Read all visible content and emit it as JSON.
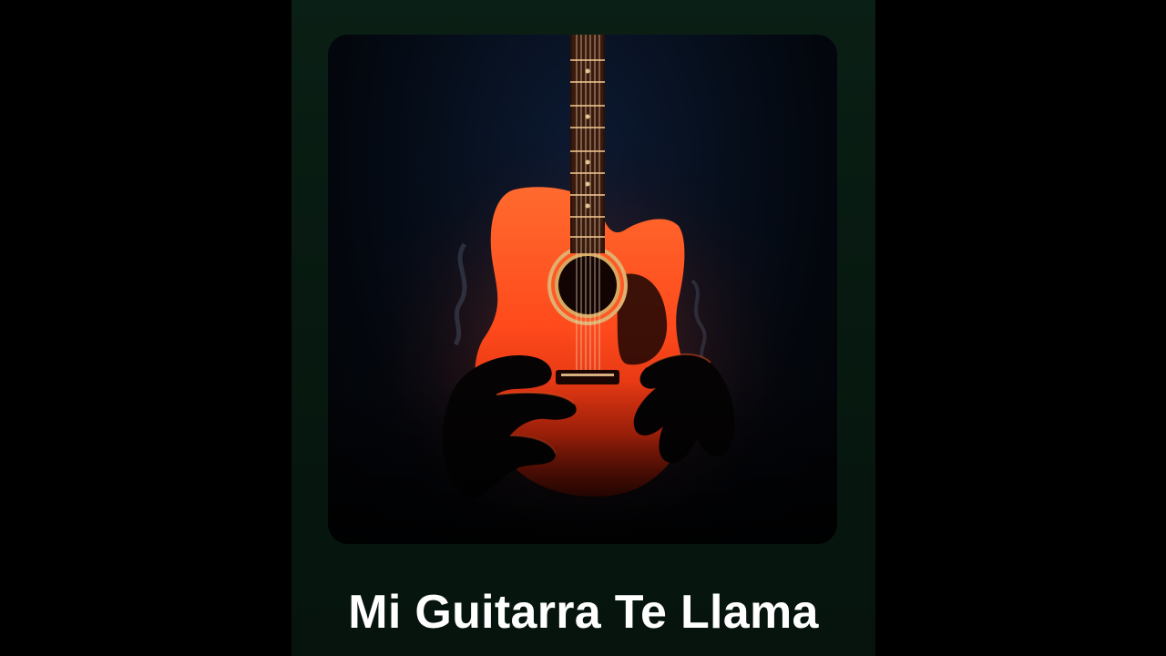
{
  "video": {
    "title": "Mi Guitarra Te Llama",
    "background_color": "#000000",
    "panel_color": "#0a1f15"
  },
  "cover_art": {
    "subject": "acoustic-guitar-with-hands",
    "guitar_color": "#ff4d1f",
    "backdrop_color": "#0d1a33"
  }
}
